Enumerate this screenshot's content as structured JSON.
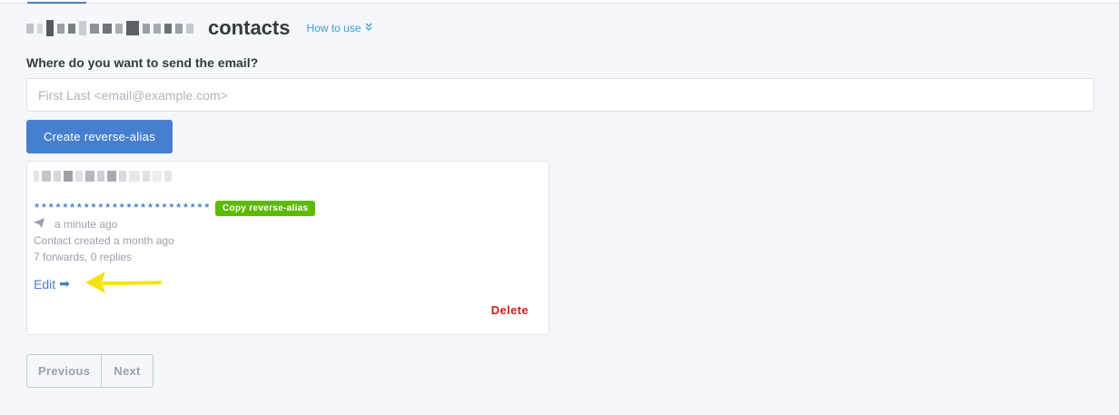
{
  "header": {
    "title": "contacts",
    "how_to_use": "How to use",
    "how_to_chevron": "»"
  },
  "form": {
    "label": "Where do you want to send the email?",
    "placeholder": "First Last <email@example.com>",
    "value": "",
    "create_button": "Create reverse-alias"
  },
  "contact": {
    "reverse_alias_masked": "*************************",
    "copy_button": "Copy reverse-alias",
    "last_email": "a minute ago",
    "created": "Contact created a month ago",
    "stats": "7 forwards, 0 replies",
    "edit": "Edit",
    "edit_arrow": "➡",
    "delete": "Delete"
  },
  "pagination": {
    "previous": "Previous",
    "next": "Next"
  },
  "colors": {
    "primary": "#467fcf",
    "success": "#5eba00",
    "danger": "#cd201f",
    "annotation": "#f5e311"
  },
  "icons": {
    "send": "paper-plane-icon",
    "chevron": "double-chevron-down-icon",
    "arrow": "arrow-right-icon"
  }
}
